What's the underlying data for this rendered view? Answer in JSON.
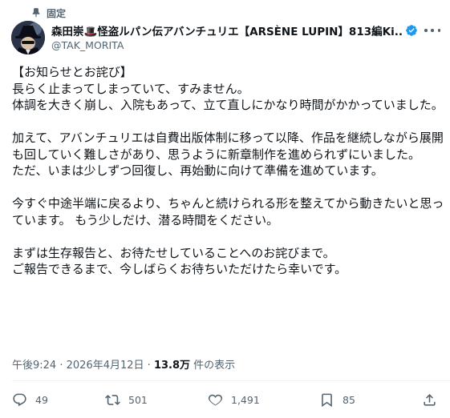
{
  "pinned": {
    "label": "固定"
  },
  "author": {
    "display_name": "森田崇🎩怪盗ルパン伝アバンチュリエ【ARSÈNE LUPIN】813編Ki...",
    "handle": "@TAK_MORITA"
  },
  "post": {
    "lines": [
      "【お知らせとお詫び】",
      "長らく止まってしまっていて、すみません。",
      "体調を大きく崩し、入院もあって、立て直しにかなり時間がかかっていました。",
      "",
      "加えて、アバンチュリエは自費出版体制に移って以降、作品を継続しながら展開も回していく難しさがあり、思うように新章制作を進められずにいました。",
      "ただ、いまは少しずつ回復し、再始動に向けて準備を進めています。",
      "",
      "今すぐ中途半端に戻るより、ちゃんと続けられる形を整えてから動きたいと思っています。 もう少しだけ、潜る時間をください。",
      "",
      "まずは生存報告と、お待たせしていることへのお詫びまで。",
      "ご報告できるまで、今しばらくお待ちいただけたら幸いです。"
    ]
  },
  "meta": {
    "time": "午後9:24",
    "separator": "·",
    "date": "2026年4月12日",
    "views_count": "13.8万",
    "views_label": "件の表示"
  },
  "actions": {
    "replies": "49",
    "reposts": "501",
    "likes": "1,491",
    "bookmarks": "85"
  },
  "colors": {
    "text": "#0f1419",
    "secondary": "#536471",
    "verified": "#1d9bf0",
    "divider": "#eff3f4"
  },
  "icons": {
    "pin": "pin-icon",
    "verified": "verified-badge-icon",
    "more": "more-icon",
    "reply": "reply-icon",
    "repost": "repost-icon",
    "like": "heart-icon",
    "bookmark": "bookmark-icon",
    "share": "share-icon"
  }
}
